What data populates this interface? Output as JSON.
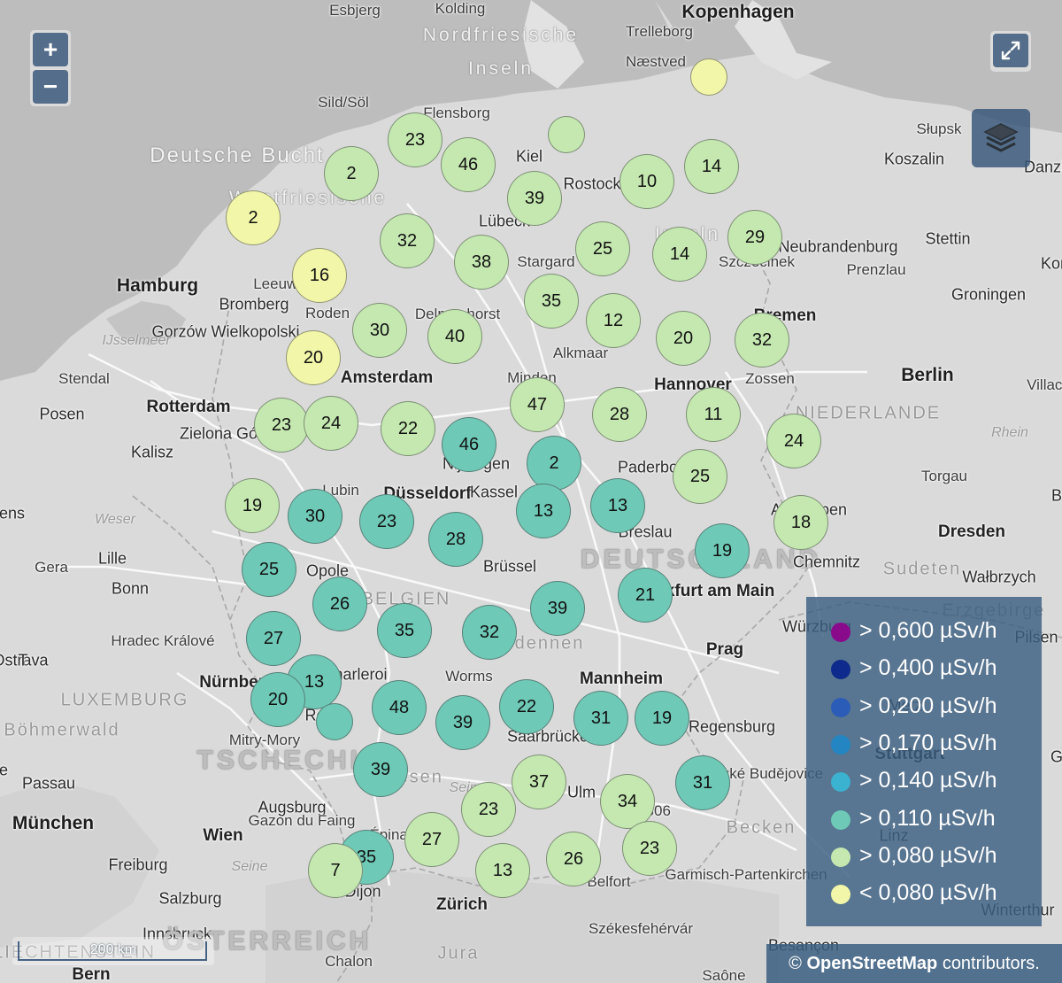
{
  "map": {
    "zoom_in_label": "+",
    "zoom_out_label": "−",
    "fullscreen_icon": "expand-icon",
    "layers_icon": "layers-icon",
    "scale_label": "200 km",
    "attribution": {
      "symbol": "©",
      "source": "OpenStreetMap",
      "suffix": "contributors."
    }
  },
  "legend": [
    {
      "label": "> 0,600 µSv/h",
      "color": "#8a0a8c"
    },
    {
      "label": "> 0,400 µSv/h",
      "color": "#0d2a8c"
    },
    {
      "label": "> 0,200 µSv/h",
      "color": "#2b5cb8"
    },
    {
      "label": "> 0,170 µSv/h",
      "color": "#2385c2"
    },
    {
      "label": "> 0,140 µSv/h",
      "color": "#3bb2cf"
    },
    {
      "label": "> 0,110 µSv/h",
      "color": "#6ec9b7"
    },
    {
      "label": "> 0,080 µSv/h",
      "color": "#c4e8b0"
    },
    {
      "label": "< 0,080 µSv/h",
      "color": "#f1f6a8"
    }
  ],
  "places": [
    {
      "name": "Esbjerg",
      "style": "l4"
    },
    {
      "name": "Kolding",
      "style": "l4"
    },
    {
      "name": "Kopenhagen",
      "style": "l1"
    },
    {
      "name": "Nordfriesische",
      "style": "island"
    },
    {
      "name": "Trelleborg",
      "style": "l4"
    },
    {
      "name": "Inseln",
      "style": "island"
    },
    {
      "name": "Næstved",
      "style": "l4"
    },
    {
      "name": "Sild/Söl",
      "style": "l4"
    },
    {
      "name": "Flensborg",
      "style": "l4"
    },
    {
      "name": "Słupsk",
      "style": "l4"
    },
    {
      "name": "Deutsche Bucht",
      "style": "sea"
    },
    {
      "name": "Kiel",
      "style": "l3"
    },
    {
      "name": "Koszalin",
      "style": "l3"
    },
    {
      "name": "Danzig",
      "style": "l3"
    },
    {
      "name": "Westfriesische",
      "style": "island"
    },
    {
      "name": "Rostock",
      "style": "l3"
    },
    {
      "name": "Lübeck",
      "style": "l3"
    },
    {
      "name": "Inseln",
      "style": "island"
    },
    {
      "name": "Neubrandenburg",
      "style": "l3"
    },
    {
      "name": "Stettin",
      "style": "l3"
    },
    {
      "name": "Szczecinek",
      "style": "l4"
    },
    {
      "name": "Prenzlau",
      "style": "l4"
    },
    {
      "name": "Stargard",
      "style": "l4"
    },
    {
      "name": "Hamburg",
      "style": "l1"
    },
    {
      "name": "Leeuwarden",
      "style": "l4"
    },
    {
      "name": "Groningen",
      "style": "l3"
    },
    {
      "name": "Bromberg",
      "style": "l3"
    },
    {
      "name": "Roden",
      "style": "l4"
    },
    {
      "name": "Delmenhorst",
      "style": "l4"
    },
    {
      "name": "Bremen",
      "style": "l2"
    },
    {
      "name": "Gorzów Wielkopolski",
      "style": "l3"
    },
    {
      "name": "IJsselmeer",
      "style": "water"
    },
    {
      "name": "Alkmaar",
      "style": "l4"
    },
    {
      "name": "Stendal",
      "style": "l4"
    },
    {
      "name": "Amsterdam",
      "style": "l2"
    },
    {
      "name": "Minden",
      "style": "l4"
    },
    {
      "name": "Hannover",
      "style": "l2"
    },
    {
      "name": "Zossen",
      "style": "l4"
    },
    {
      "name": "Berlin",
      "style": "l1"
    },
    {
      "name": "Posen",
      "style": "l3"
    },
    {
      "name": "Rotterdam",
      "style": "l2"
    },
    {
      "name": "NIEDERLANDE",
      "style": "region"
    },
    {
      "name": "Zielona Góra",
      "style": "l3"
    },
    {
      "name": "Rhein",
      "style": "water"
    },
    {
      "name": "Kalisz",
      "style": "l3"
    },
    {
      "name": "Nijmegen",
      "style": "l3"
    },
    {
      "name": "Paderborn",
      "style": "l3"
    },
    {
      "name": "Torgau",
      "style": "l4"
    },
    {
      "name": "Lubin",
      "style": "l4"
    },
    {
      "name": "Düsseldorf",
      "style": "l2"
    },
    {
      "name": "Kassel",
      "style": "l3"
    },
    {
      "name": "Weser",
      "style": "water"
    },
    {
      "name": "Antwerpen",
      "style": "l3"
    },
    {
      "name": "Dresden",
      "style": "l2"
    },
    {
      "name": "Breslau",
      "style": "l3"
    },
    {
      "name": "Gera",
      "style": "l4"
    },
    {
      "name": "Lille",
      "style": "l3"
    },
    {
      "name": "Brüssel",
      "style": "l3"
    },
    {
      "name": "DEUTSCHLAND",
      "style": "country"
    },
    {
      "name": "Chemnitz",
      "style": "l3"
    },
    {
      "name": "Sudeten",
      "style": "region"
    },
    {
      "name": "Wałbrzych",
      "style": "l3"
    },
    {
      "name": "Opole",
      "style": "l3"
    },
    {
      "name": "Bonn",
      "style": "l3"
    },
    {
      "name": "BELGIEN",
      "style": "region"
    },
    {
      "name": "Frankfurt am Main",
      "style": "l2"
    },
    {
      "name": "Erzgebirge",
      "style": "region"
    },
    {
      "name": "Hradec Králové",
      "style": "l4"
    },
    {
      "name": "Ardennen",
      "style": "region"
    },
    {
      "name": "Würzburg",
      "style": "l3"
    },
    {
      "name": "Prag",
      "style": "l2"
    },
    {
      "name": "Pilsen",
      "style": "l3"
    },
    {
      "name": "Ostrava",
      "style": "l3"
    },
    {
      "name": "Charleroi",
      "style": "l3"
    },
    {
      "name": "Worms",
      "style": "l4"
    },
    {
      "name": "Mannheim",
      "style": "l2"
    },
    {
      "name": "Nürnberg",
      "style": "l2"
    },
    {
      "name": "LUXEMBURG",
      "style": "region"
    },
    {
      "name": "Reims",
      "style": "l3"
    },
    {
      "name": "Saarbrücken",
      "style": "l3"
    },
    {
      "name": "Regensburg",
      "style": "l3"
    },
    {
      "name": "Böhmerwald",
      "style": "region"
    },
    {
      "name": "Mitry-Mory",
      "style": "l4"
    },
    {
      "name": "Metz",
      "style": "l3"
    },
    {
      "name": "TSCHECHIEN",
      "style": "country"
    },
    {
      "name": "Vogesen",
      "style": "region"
    },
    {
      "name": "Stuttgart",
      "style": "l2"
    },
    {
      "name": "České Budějovice",
      "style": "l4"
    },
    {
      "name": "Passau",
      "style": "l3"
    },
    {
      "name": "Seine",
      "style": "water"
    },
    {
      "name": "Ulm",
      "style": "l3"
    },
    {
      "name": "Augsburg",
      "style": "l3"
    },
    {
      "name": "Gazon du Faing",
      "style": "l4"
    },
    {
      "name": "1306",
      "style": "l4"
    },
    {
      "name": "München",
      "style": "l1"
    },
    {
      "name": "Becken",
      "style": "region"
    },
    {
      "name": "Linz",
      "style": "l3"
    },
    {
      "name": "Wien",
      "style": "l2"
    },
    {
      "name": "Épinal",
      "style": "l4"
    },
    {
      "name": "Freiburg",
      "style": "l3"
    },
    {
      "name": "Seine",
      "style": "water"
    },
    {
      "name": "Belfort",
      "style": "l4"
    },
    {
      "name": "Garmisch-Partenkirchen",
      "style": "l4"
    },
    {
      "name": "Salzburg",
      "style": "l3"
    },
    {
      "name": "Dijon",
      "style": "l3"
    },
    {
      "name": "Zürich",
      "style": "l2"
    },
    {
      "name": "Winterthur",
      "style": "l3"
    },
    {
      "name": "Székesfehérvár",
      "style": "l4"
    },
    {
      "name": "Innsbruck",
      "style": "l3"
    },
    {
      "name": "Besançon",
      "style": "l3"
    },
    {
      "name": "ÖSTERREICH",
      "style": "country"
    },
    {
      "name": "Jura",
      "style": "region"
    },
    {
      "name": "LIECHTENSTEIN",
      "style": "region"
    },
    {
      "name": "Chalon",
      "style": "l4"
    },
    {
      "name": "Bern",
      "style": "l2"
    },
    {
      "name": "Saône",
      "style": "l4"
    },
    {
      "name": "Villach",
      "style": "l4"
    },
    {
      "name": "Kon",
      "style": "l3"
    },
    {
      "name": "G",
      "style": "l3"
    },
    {
      "name": "B",
      "style": "l3"
    },
    {
      "name": "T",
      "style": "l3"
    },
    {
      "name": "miens",
      "style": "l3"
    },
    {
      "name": "e",
      "style": "l3"
    },
    {
      "name": "s",
      "style": "l3"
    }
  ],
  "clusters": [
    {
      "count": "",
      "category": "lt080"
    },
    {
      "count": "",
      "category": "gt080"
    },
    {
      "count": "23",
      "category": "gt080"
    },
    {
      "count": "46",
      "category": "gt080"
    },
    {
      "count": "14",
      "category": "gt080"
    },
    {
      "count": "2",
      "category": "gt080"
    },
    {
      "count": "10",
      "category": "gt080"
    },
    {
      "count": "39",
      "category": "gt080"
    },
    {
      "count": "2",
      "category": "lt080"
    },
    {
      "count": "32",
      "category": "gt080"
    },
    {
      "count": "25",
      "category": "gt080"
    },
    {
      "count": "29",
      "category": "gt080"
    },
    {
      "count": "38",
      "category": "gt080"
    },
    {
      "count": "14",
      "category": "gt080"
    },
    {
      "count": "16",
      "category": "lt080"
    },
    {
      "count": "35",
      "category": "gt080"
    },
    {
      "count": "12",
      "category": "gt080"
    },
    {
      "count": "30",
      "category": "gt080"
    },
    {
      "count": "40",
      "category": "gt080"
    },
    {
      "count": "20",
      "category": "gt080"
    },
    {
      "count": "32",
      "category": "gt080"
    },
    {
      "count": "20",
      "category": "lt080"
    },
    {
      "count": "47",
      "category": "gt080"
    },
    {
      "count": "28",
      "category": "gt080"
    },
    {
      "count": "11",
      "category": "gt080"
    },
    {
      "count": "23",
      "category": "gt080"
    },
    {
      "count": "24",
      "category": "gt080"
    },
    {
      "count": "22",
      "category": "gt080"
    },
    {
      "count": "46",
      "category": "gt110"
    },
    {
      "count": "24",
      "category": "gt080"
    },
    {
      "count": "2",
      "category": "gt110"
    },
    {
      "count": "25",
      "category": "gt080"
    },
    {
      "count": "19",
      "category": "gt080"
    },
    {
      "count": "30",
      "category": "gt110"
    },
    {
      "count": "23",
      "category": "gt110"
    },
    {
      "count": "13",
      "category": "gt110"
    },
    {
      "count": "13",
      "category": "gt110"
    },
    {
      "count": "18",
      "category": "gt080"
    },
    {
      "count": "28",
      "category": "gt110"
    },
    {
      "count": "19",
      "category": "gt110"
    },
    {
      "count": "25",
      "category": "gt110"
    },
    {
      "count": "21",
      "category": "gt110"
    },
    {
      "count": "26",
      "category": "gt110"
    },
    {
      "count": "39",
      "category": "gt110"
    },
    {
      "count": "35",
      "category": "gt110"
    },
    {
      "count": "32",
      "category": "gt110"
    },
    {
      "count": "27",
      "category": "gt110"
    },
    {
      "count": "13",
      "category": "gt110"
    },
    {
      "count": "20",
      "category": "gt110"
    },
    {
      "count": "48",
      "category": "gt110"
    },
    {
      "count": "22",
      "category": "gt110"
    },
    {
      "count": "31",
      "category": "gt110"
    },
    {
      "count": "19",
      "category": "gt110"
    },
    {
      "count": "39",
      "category": "gt110"
    },
    {
      "count": "",
      "category": "gt110"
    },
    {
      "count": "39",
      "category": "gt110"
    },
    {
      "count": "37",
      "category": "gt080"
    },
    {
      "count": "31",
      "category": "gt110"
    },
    {
      "count": "34",
      "category": "gt080"
    },
    {
      "count": "23",
      "category": "gt080"
    },
    {
      "count": "35",
      "category": "gt110"
    },
    {
      "count": "27",
      "category": "gt080"
    },
    {
      "count": "23",
      "category": "gt080"
    },
    {
      "count": "26",
      "category": "gt080"
    },
    {
      "count": "13",
      "category": "gt080"
    },
    {
      "count": "7",
      "category": "gt080"
    }
  ]
}
